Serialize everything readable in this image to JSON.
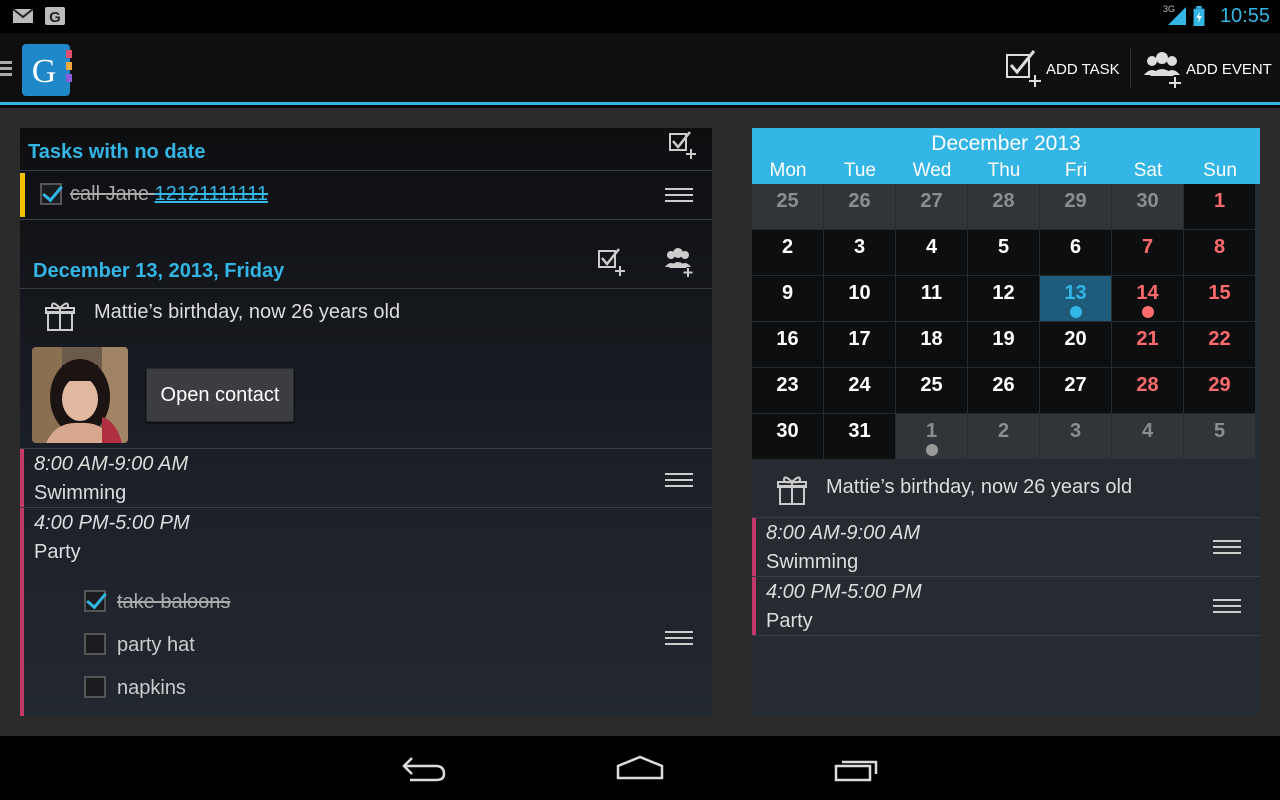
{
  "status": {
    "time": "10:55",
    "network": "3G",
    "icons": [
      "gmail-icon",
      "google-icon",
      "signal-icon",
      "battery-icon"
    ]
  },
  "actionbar": {
    "add_task": "ADD TASK",
    "add_event": "ADD EVENT"
  },
  "left": {
    "no_date_title": "Tasks with no date",
    "no_date_task": {
      "text": "call Jane ",
      "phone": "12121111111",
      "done": true
    },
    "date_title": "December 13, 2013, Friday",
    "birthday": "Mattie’s birthday, now 26 years old",
    "open_contact": "Open contact",
    "events": [
      {
        "time": "8:00 AM-9:00 AM",
        "title": "Swimming"
      },
      {
        "time": "4:00 PM-5:00 PM",
        "title": "Party"
      }
    ],
    "party_todos": [
      {
        "text": "take baloons",
        "done": true
      },
      {
        "text": "party hat",
        "done": false
      },
      {
        "text": "napkins",
        "done": false
      }
    ]
  },
  "calendar": {
    "month": "December 2013",
    "days_of_week": [
      "Mon",
      "Tue",
      "Wed",
      "Thu",
      "Fri",
      "Sat",
      "Sun"
    ],
    "weeks": [
      [
        "25",
        "26",
        "27",
        "28",
        "29",
        "30",
        "1"
      ],
      [
        "2",
        "3",
        "4",
        "5",
        "6",
        "7",
        "8"
      ],
      [
        "9",
        "10",
        "11",
        "12",
        "13",
        "14",
        "15"
      ],
      [
        "16",
        "17",
        "18",
        "19",
        "20",
        "21",
        "22"
      ],
      [
        "23",
        "24",
        "25",
        "26",
        "27",
        "28",
        "29"
      ],
      [
        "30",
        "31",
        "1",
        "2",
        "3",
        "4",
        "5"
      ]
    ],
    "today": "13",
    "colors": {
      "accent": "#33b5e5",
      "weekend": "#ff6b6b",
      "event": "#c2386b"
    }
  },
  "right": {
    "birthday": "Mattie’s birthday, now 26 years old",
    "events": [
      {
        "time": "8:00 AM-9:00 AM",
        "title": "Swimming"
      },
      {
        "time": "4:00 PM-5:00 PM",
        "title": "Party"
      }
    ]
  }
}
